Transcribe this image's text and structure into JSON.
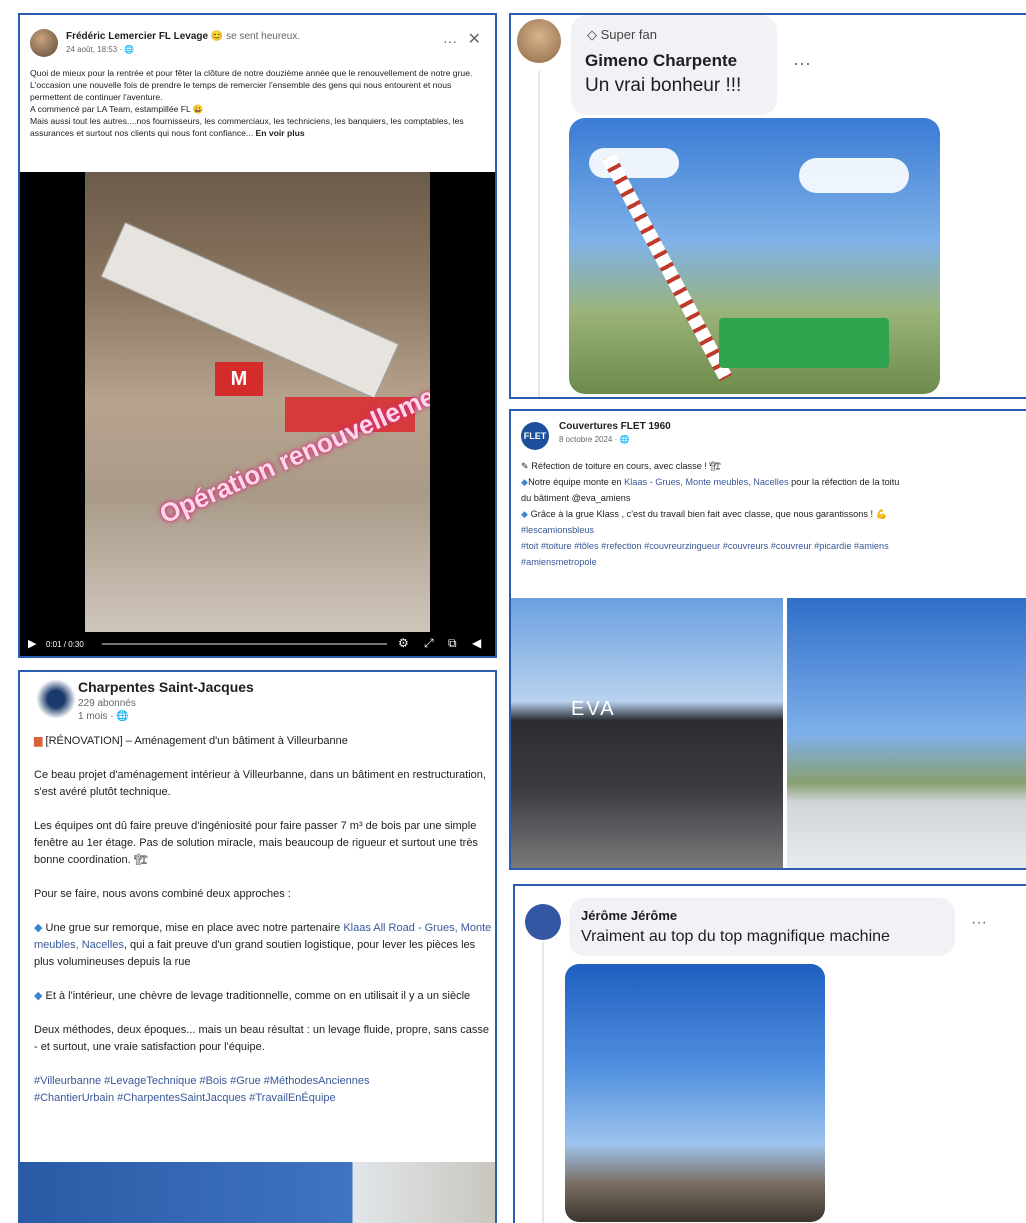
{
  "post1": {
    "author": "Frédéric Lemercier FL Levage",
    "feeling": "se sent heureux.",
    "date": "24 août, 18:53 · ",
    "lines": [
      "Quoi de mieux pour la rentrée et pour fêter la clôture de notre douzième année que le renouvellement de notre grue.",
      "L'occasion une nouvelle fois de prendre le temps de remercier l'ensemble des gens qui nous entourent et nous permettent de continuer l'aventure.",
      "A commencé par LA Team, estampillée FL",
      "Mais aussi tout les autres....nos fournisseurs, les commerciaux, les techniciens, les banquiers, les comptables, les assurances et surtout nos clients qui nous font confiance..."
    ],
    "see_more": "En voir plus",
    "overlay_text": "Opération renouvellement",
    "video_time": "0:01 / 0:30"
  },
  "post2": {
    "badge": "Super fan",
    "user": "Gimeno Charpente",
    "comment": "Un vrai bonheur !!!",
    "more": "···"
  },
  "post3": {
    "author": "Couvertures FLET 1960",
    "avatar_text": "FLET",
    "date": "8 octobre 2024 · ",
    "line1": "Réfection de toiture en cours, avec classe !",
    "line2_prefix": "Notre équipe monte en ",
    "line2_link": "Klaas - Grues, Monte meubles, Nacelles",
    "line2_suffix": " pour la réfection de la toitu",
    "line3": "du bâtiment @eva_amiens",
    "line4": "Grâce à la grue Klass , c'est du travail bien fait avec classe, que nous garantissons !",
    "tag1": "#lescamionsbleus",
    "tags2": "#toit #toiture #tôles #refection #couvreurzingueur #couvreurs #couvreur #picardie #amiens",
    "tags3": "#amiensmetropole",
    "building_sign": "EVA"
  },
  "post4": {
    "author": "Charpentes Saint-Jacques",
    "subscribers": "229 abonnés",
    "when": "1 mois · ",
    "title": "[RÉNOVATION] – Aménagement d'un bâtiment à Villeurbanne",
    "p1": "Ce beau projet d'aménagement intérieur à Villeurbanne, dans un bâtiment en restructuration, s'est avéré plutôt technique.",
    "p2": "Les équipes ont dû faire preuve d'ingéniosité pour faire passer 7 m³ de bois par une simple fenêtre au 1er étage. Pas de solution miracle, mais beaucoup de rigueur et surtout une très bonne coordination.",
    "p3": "Pour se faire, nous avons combiné deux approches :",
    "p4_prefix": "Une grue sur remorque, mise en place avec notre partenaire ",
    "p4_link": "Klaas All Road - Grues, Monte meubles, Nacelles",
    "p4_suffix": ", qui a fait preuve d'un grand soutien logistique, pour lever les pièces les plus volumineuses depuis la rue",
    "p5": "Et à l'intérieur, une chèvre de levage traditionnelle, comme on en utilisait il y a un siècle",
    "p6": "Deux méthodes, deux époques... mais un beau résultat : un levage fluide, propre, sans casse - et surtout, une vraie satisfaction pour l'équipe.",
    "hashtags1": "#Villeurbanne #LevageTechnique #Bois #Grue #MéthodesAnciennes",
    "hashtags2": "#ChantierUrbain #CharpentesSaintJacques #TravailEnÉquipe"
  },
  "post5": {
    "user": "Jérôme Jérôme",
    "comment": "Vraiment au top du top magnifique machine",
    "more": "···"
  }
}
